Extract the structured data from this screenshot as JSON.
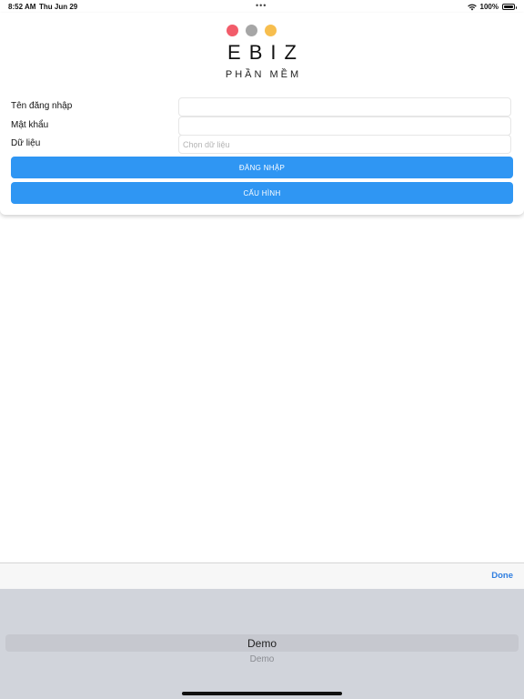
{
  "status_bar": {
    "time": "8:52 AM",
    "date": "Thu Jun 29",
    "multitasking_dots": "•••",
    "battery_percent": "100%",
    "battery_level": 1.0
  },
  "logo": {
    "dot_colors": [
      "#f25c6a",
      "#a6a6a6",
      "#f7be4e"
    ],
    "title": "EBIZ",
    "subtitle": "PHẦN MỀM"
  },
  "form": {
    "username": {
      "label": "Tên đăng nhập",
      "value": "",
      "placeholder": ""
    },
    "password": {
      "label": "Mật khẩu",
      "value": "",
      "placeholder": ""
    },
    "database": {
      "label": "Dữ liệu",
      "value": "",
      "placeholder": "Chọn dữ liệu"
    }
  },
  "buttons": {
    "login_label": "ĐĂNG NHẬP",
    "config_label": "CẤU HÌNH"
  },
  "picker_toolbar": {
    "done_label": "Done"
  },
  "picker": {
    "selected": "Demo",
    "options": [
      "Demo",
      "Demo"
    ]
  },
  "colors": {
    "accent": "#2f96f3",
    "done_text": "#2f7ee0",
    "picker_background": "#d1d4db"
  },
  "icons": {
    "wifi": "wifi-icon",
    "battery": "battery-icon"
  }
}
